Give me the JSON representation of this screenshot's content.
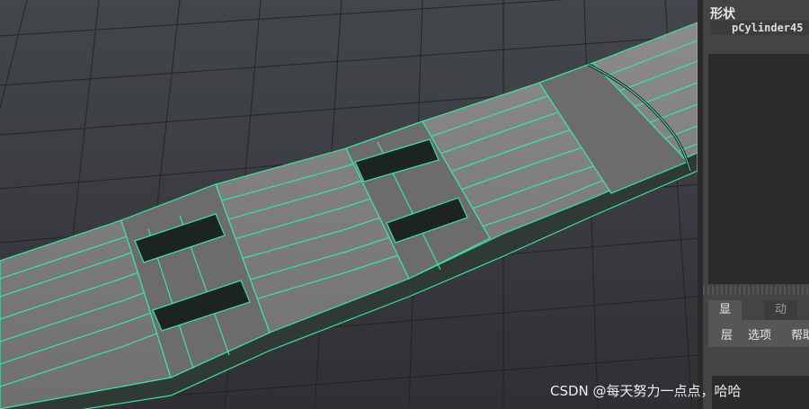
{
  "viewport": {
    "object_name": "pCylinder45",
    "wire_color": "#3fe0a0",
    "face_color": "#7a7a7a"
  },
  "panel": {
    "title": "形状",
    "node": "pCylinder45",
    "tabs": [
      {
        "label": "显示",
        "active": true
      },
      {
        "label": "动画",
        "active": false
      }
    ],
    "menu": [
      "层",
      "选项",
      "帮助"
    ]
  },
  "watermark": "CSDN @每天努力一点点，哈哈"
}
